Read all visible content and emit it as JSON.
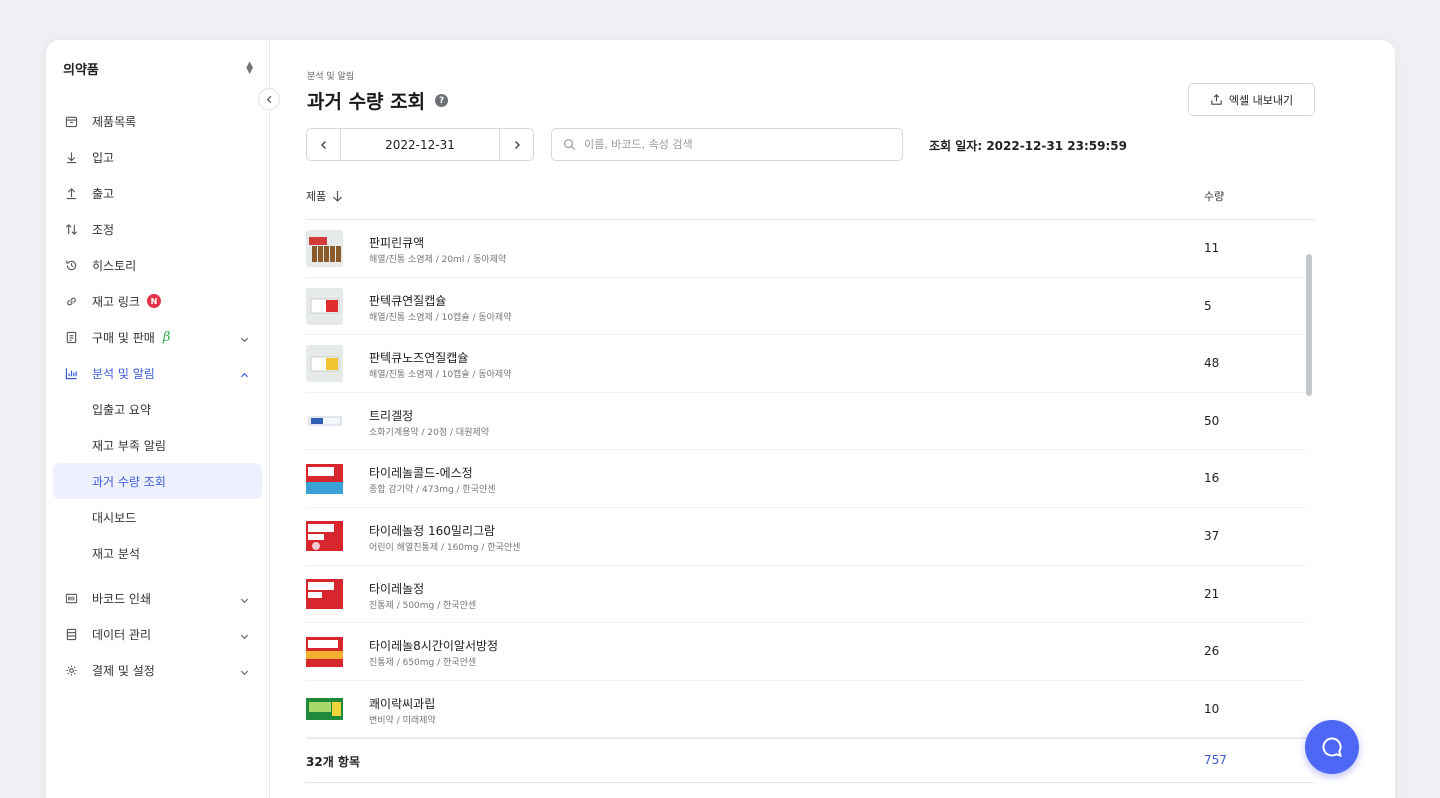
{
  "sidebar": {
    "brand": "의약품",
    "items": [
      {
        "label": "제품목록",
        "icon": "box-icon"
      },
      {
        "label": "입고",
        "icon": "arrow-down-icon"
      },
      {
        "label": "출고",
        "icon": "arrow-up-icon"
      },
      {
        "label": "조정",
        "icon": "swap-icon"
      },
      {
        "label": "히스토리",
        "icon": "history-icon"
      },
      {
        "label": "재고 링크",
        "icon": "link-icon",
        "badge": "N"
      },
      {
        "label": "구매 및 판매",
        "icon": "receipt-icon",
        "beta": "β"
      },
      {
        "label": "분석 및 알림",
        "icon": "chart-icon"
      }
    ],
    "sub_items": [
      "입출고 요약",
      "재고 부족 알림",
      "과거 수량 조회",
      "대시보드",
      "재고 분석"
    ],
    "bottom_items": [
      {
        "label": "바코드 인쇄",
        "icon": "barcode-icon"
      },
      {
        "label": "데이터 관리",
        "icon": "database-icon"
      },
      {
        "label": "결제 및 설정",
        "icon": "gear-icon"
      }
    ],
    "accent_color": "#3d5bd9"
  },
  "header": {
    "breadcrumb": "분석 및 알림",
    "title": "과거 수량 조회",
    "help": "?",
    "export_label": "엑셀 내보내기"
  },
  "filters": {
    "date": "2022-12-31",
    "search_placeholder": "이름, 바코드, 속성 검색",
    "query_date": "조회 일자: 2022-12-31 23:59:59"
  },
  "table": {
    "col_product": "제품",
    "col_qty": "수량",
    "rows": [
      {
        "name": "판피린큐액",
        "desc": "해열/진통 소염제 / 20ml / 동아제약",
        "qty": "11"
      },
      {
        "name": "판텍큐연질캡슐",
        "desc": "해열/진통 소염제 / 10캡슐 / 동아제약",
        "qty": "5"
      },
      {
        "name": "판텍큐노즈연질캡슐",
        "desc": "해열/진통 소염제 / 10캡슐 / 동아제약",
        "qty": "48"
      },
      {
        "name": "트리겔정",
        "desc": "소화기계용약 / 20정 / 대원제약",
        "qty": "50"
      },
      {
        "name": "타이레놀콜드-에스정",
        "desc": "종합 감기약 / 473mg / 한국얀센",
        "qty": "16"
      },
      {
        "name": "타이레놀정 160밀리그람",
        "desc": "어린이 해열진통제 / 160mg / 한국얀센",
        "qty": "37"
      },
      {
        "name": "타이레놀정",
        "desc": "진통제 / 500mg / 한국얀센",
        "qty": "21"
      },
      {
        "name": "타이레놀8시간이알서방정",
        "desc": "진통제 / 650mg / 한국얀센",
        "qty": "26"
      },
      {
        "name": "쾌이락씨과립",
        "desc": "변비약 / 미래제약",
        "qty": "10"
      }
    ],
    "footer_count": "32개 항목",
    "footer_total": "757"
  }
}
